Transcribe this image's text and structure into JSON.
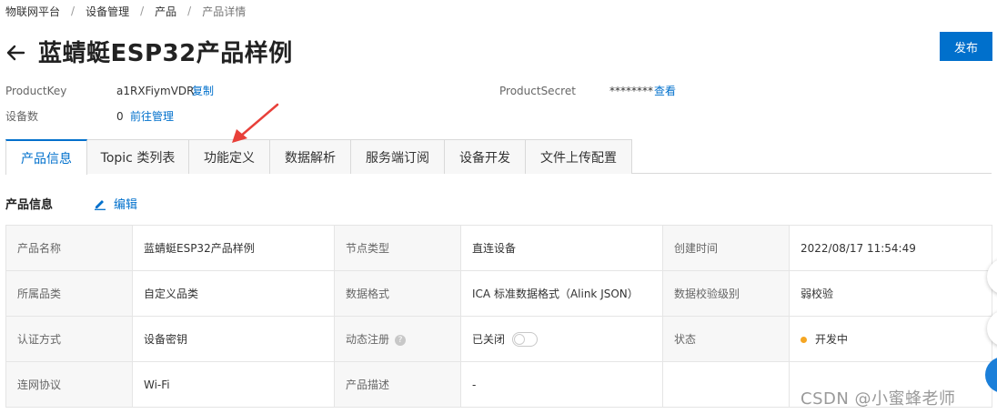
{
  "breadcrumb": [
    "物联网平台",
    "设备管理",
    "产品",
    "产品详情"
  ],
  "page": {
    "title": "蓝蜻蜓ESP32产品样例",
    "publish_label": "发布"
  },
  "meta": {
    "product_key_label": "ProductKey",
    "product_key_value": "a1RXFiymVDR",
    "copy_label": "复制",
    "product_secret_label": "ProductSecret",
    "product_secret_value": "********",
    "view_label": "查看",
    "device_count_label": "设备数",
    "device_count_value": "0",
    "manage_label": "前往管理"
  },
  "tabs": [
    "产品信息",
    "Topic 类列表",
    "功能定义",
    "数据解析",
    "服务端订阅",
    "设备开发",
    "文件上传配置"
  ],
  "section": {
    "title": "产品信息",
    "edit_label": "编辑"
  },
  "info": {
    "rows": [
      [
        {
          "k": "产品名称",
          "v": "蓝蜻蜓ESP32产品样例"
        },
        {
          "k": "节点类型",
          "v": "直连设备"
        },
        {
          "k": "创建时间",
          "v": "2022/08/17 11:54:49"
        }
      ],
      [
        {
          "k": "所属品类",
          "v": "自定义品类"
        },
        {
          "k": "数据格式",
          "v": "ICA 标准数据格式（Alink JSON）"
        },
        {
          "k": "数据校验级别",
          "v": "弱校验"
        }
      ],
      [
        {
          "k": "认证方式",
          "v": "设备密钥"
        },
        {
          "k": "动态注册",
          "v": "已关闭"
        },
        {
          "k": "状态",
          "v": "开发中"
        }
      ],
      [
        {
          "k": "连网协议",
          "v": "Wi-Fi"
        },
        {
          "k": "产品描述",
          "v": "-"
        },
        {
          "k": "",
          "v": ""
        }
      ]
    ]
  },
  "colors": {
    "accent": "#0070cc",
    "status_dev": "#f5a623"
  },
  "watermark": "CSDN @小蜜蜂老师"
}
